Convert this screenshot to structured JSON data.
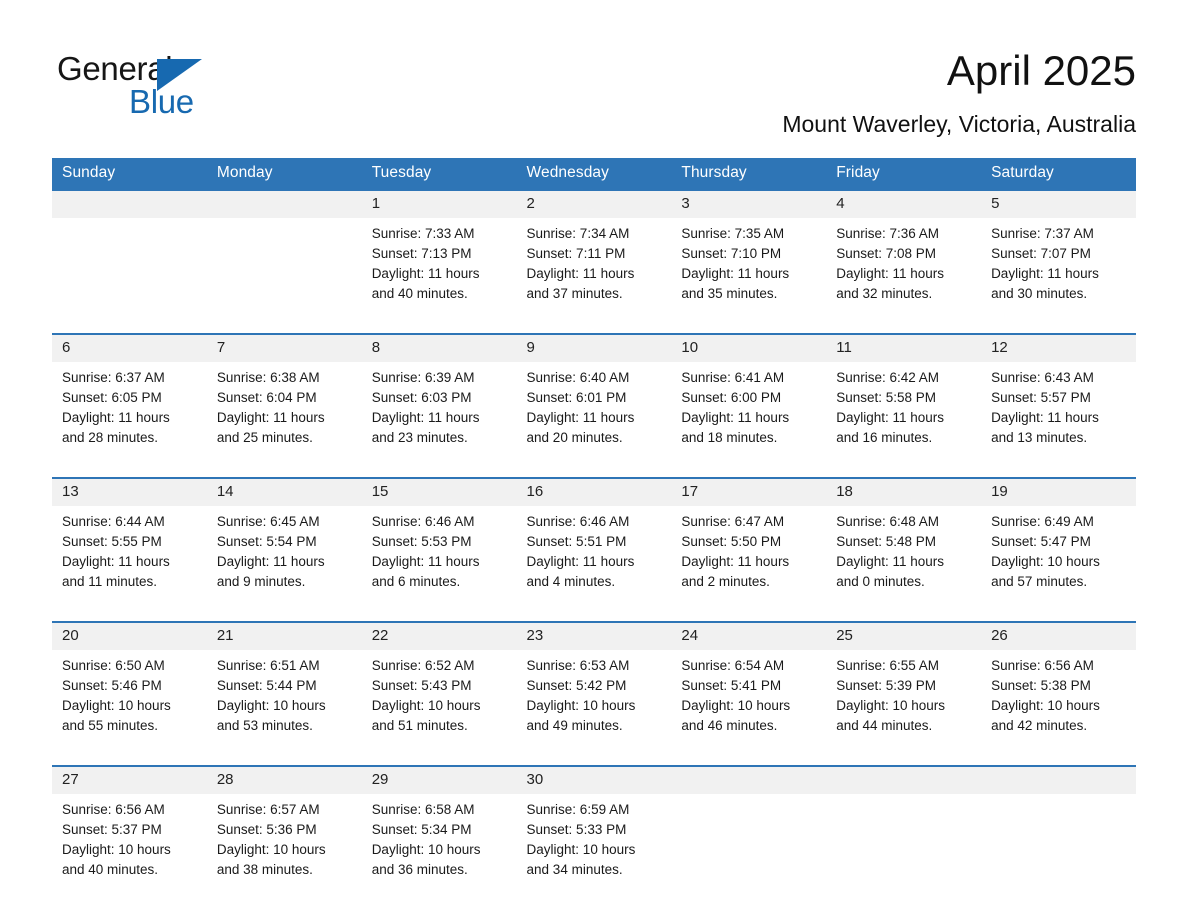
{
  "brand": {
    "name_part1": "General",
    "name_part2": "Blue",
    "triangle_color": "#1769b0"
  },
  "header": {
    "title": "April 2025",
    "location": "Mount Waverley, Victoria, Australia"
  },
  "theme": {
    "header_blue": "#2e75b6",
    "daynum_band": "#f1f1f1",
    "page_background": "#ffffff",
    "text": "#1a1a1a"
  },
  "calendar": {
    "weekday_headers": [
      "Sunday",
      "Monday",
      "Tuesday",
      "Wednesday",
      "Thursday",
      "Friday",
      "Saturday"
    ],
    "weeks": [
      [
        {
          "day": "",
          "lines": []
        },
        {
          "day": "",
          "lines": []
        },
        {
          "day": "1",
          "lines": [
            "Sunrise: 7:33 AM",
            "Sunset: 7:13 PM",
            "Daylight: 11 hours",
            "and 40 minutes."
          ]
        },
        {
          "day": "2",
          "lines": [
            "Sunrise: 7:34 AM",
            "Sunset: 7:11 PM",
            "Daylight: 11 hours",
            "and 37 minutes."
          ]
        },
        {
          "day": "3",
          "lines": [
            "Sunrise: 7:35 AM",
            "Sunset: 7:10 PM",
            "Daylight: 11 hours",
            "and 35 minutes."
          ]
        },
        {
          "day": "4",
          "lines": [
            "Sunrise: 7:36 AM",
            "Sunset: 7:08 PM",
            "Daylight: 11 hours",
            "and 32 minutes."
          ]
        },
        {
          "day": "5",
          "lines": [
            "Sunrise: 7:37 AM",
            "Sunset: 7:07 PM",
            "Daylight: 11 hours",
            "and 30 minutes."
          ]
        }
      ],
      [
        {
          "day": "6",
          "lines": [
            "Sunrise: 6:37 AM",
            "Sunset: 6:05 PM",
            "Daylight: 11 hours",
            "and 28 minutes."
          ]
        },
        {
          "day": "7",
          "lines": [
            "Sunrise: 6:38 AM",
            "Sunset: 6:04 PM",
            "Daylight: 11 hours",
            "and 25 minutes."
          ]
        },
        {
          "day": "8",
          "lines": [
            "Sunrise: 6:39 AM",
            "Sunset: 6:03 PM",
            "Daylight: 11 hours",
            "and 23 minutes."
          ]
        },
        {
          "day": "9",
          "lines": [
            "Sunrise: 6:40 AM",
            "Sunset: 6:01 PM",
            "Daylight: 11 hours",
            "and 20 minutes."
          ]
        },
        {
          "day": "10",
          "lines": [
            "Sunrise: 6:41 AM",
            "Sunset: 6:00 PM",
            "Daylight: 11 hours",
            "and 18 minutes."
          ]
        },
        {
          "day": "11",
          "lines": [
            "Sunrise: 6:42 AM",
            "Sunset: 5:58 PM",
            "Daylight: 11 hours",
            "and 16 minutes."
          ]
        },
        {
          "day": "12",
          "lines": [
            "Sunrise: 6:43 AM",
            "Sunset: 5:57 PM",
            "Daylight: 11 hours",
            "and 13 minutes."
          ]
        }
      ],
      [
        {
          "day": "13",
          "lines": [
            "Sunrise: 6:44 AM",
            "Sunset: 5:55 PM",
            "Daylight: 11 hours",
            "and 11 minutes."
          ]
        },
        {
          "day": "14",
          "lines": [
            "Sunrise: 6:45 AM",
            "Sunset: 5:54 PM",
            "Daylight: 11 hours",
            "and 9 minutes."
          ]
        },
        {
          "day": "15",
          "lines": [
            "Sunrise: 6:46 AM",
            "Sunset: 5:53 PM",
            "Daylight: 11 hours",
            "and 6 minutes."
          ]
        },
        {
          "day": "16",
          "lines": [
            "Sunrise: 6:46 AM",
            "Sunset: 5:51 PM",
            "Daylight: 11 hours",
            "and 4 minutes."
          ]
        },
        {
          "day": "17",
          "lines": [
            "Sunrise: 6:47 AM",
            "Sunset: 5:50 PM",
            "Daylight: 11 hours",
            "and 2 minutes."
          ]
        },
        {
          "day": "18",
          "lines": [
            "Sunrise: 6:48 AM",
            "Sunset: 5:48 PM",
            "Daylight: 11 hours",
            "and 0 minutes."
          ]
        },
        {
          "day": "19",
          "lines": [
            "Sunrise: 6:49 AM",
            "Sunset: 5:47 PM",
            "Daylight: 10 hours",
            "and 57 minutes."
          ]
        }
      ],
      [
        {
          "day": "20",
          "lines": [
            "Sunrise: 6:50 AM",
            "Sunset: 5:46 PM",
            "Daylight: 10 hours",
            "and 55 minutes."
          ]
        },
        {
          "day": "21",
          "lines": [
            "Sunrise: 6:51 AM",
            "Sunset: 5:44 PM",
            "Daylight: 10 hours",
            "and 53 minutes."
          ]
        },
        {
          "day": "22",
          "lines": [
            "Sunrise: 6:52 AM",
            "Sunset: 5:43 PM",
            "Daylight: 10 hours",
            "and 51 minutes."
          ]
        },
        {
          "day": "23",
          "lines": [
            "Sunrise: 6:53 AM",
            "Sunset: 5:42 PM",
            "Daylight: 10 hours",
            "and 49 minutes."
          ]
        },
        {
          "day": "24",
          "lines": [
            "Sunrise: 6:54 AM",
            "Sunset: 5:41 PM",
            "Daylight: 10 hours",
            "and 46 minutes."
          ]
        },
        {
          "day": "25",
          "lines": [
            "Sunrise: 6:55 AM",
            "Sunset: 5:39 PM",
            "Daylight: 10 hours",
            "and 44 minutes."
          ]
        },
        {
          "day": "26",
          "lines": [
            "Sunrise: 6:56 AM",
            "Sunset: 5:38 PM",
            "Daylight: 10 hours",
            "and 42 minutes."
          ]
        }
      ],
      [
        {
          "day": "27",
          "lines": [
            "Sunrise: 6:56 AM",
            "Sunset: 5:37 PM",
            "Daylight: 10 hours",
            "and 40 minutes."
          ]
        },
        {
          "day": "28",
          "lines": [
            "Sunrise: 6:57 AM",
            "Sunset: 5:36 PM",
            "Daylight: 10 hours",
            "and 38 minutes."
          ]
        },
        {
          "day": "29",
          "lines": [
            "Sunrise: 6:58 AM",
            "Sunset: 5:34 PM",
            "Daylight: 10 hours",
            "and 36 minutes."
          ]
        },
        {
          "day": "30",
          "lines": [
            "Sunrise: 6:59 AM",
            "Sunset: 5:33 PM",
            "Daylight: 10 hours",
            "and 34 minutes."
          ]
        },
        {
          "day": "",
          "lines": []
        },
        {
          "day": "",
          "lines": []
        },
        {
          "day": "",
          "lines": []
        }
      ]
    ]
  }
}
